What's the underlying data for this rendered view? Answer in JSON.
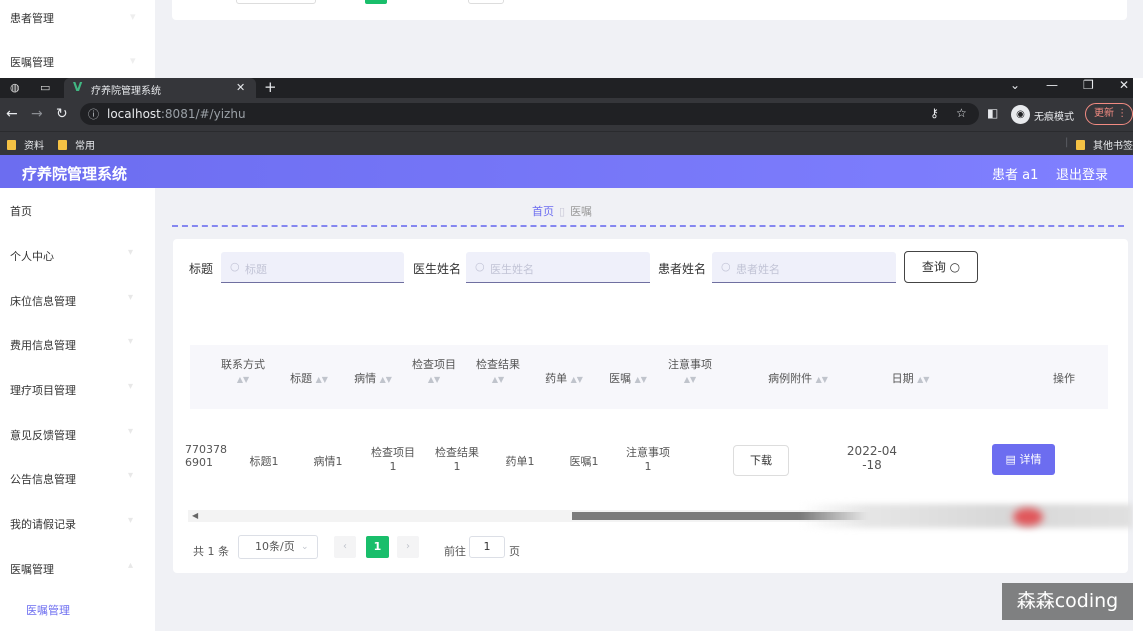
{
  "ghost": {
    "items": [
      "患者管理",
      "医嘱管理"
    ]
  },
  "browser": {
    "tab_title": "疗养院管理系统",
    "url_host": "localhost",
    "url_path": ":8081/#/yizhu",
    "profile_label": "无痕模式",
    "update_label": "更新",
    "bookmarks": [
      "资料",
      "常用"
    ],
    "other_bookmarks": "其他书签"
  },
  "header": {
    "title": "疗养院管理系统",
    "user": "患者 a1",
    "logout": "退出登录"
  },
  "sidebar": {
    "items": [
      "首页",
      "个人中心",
      "床位信息管理",
      "费用信息管理",
      "理疗项目管理",
      "意见反馈管理",
      "公告信息管理",
      "我的请假记录",
      "医嘱管理"
    ],
    "sub_item": "医嘱管理"
  },
  "breadcrumb": {
    "home": "首页",
    "current": "医嘱"
  },
  "search": {
    "title_label": "标题",
    "title_placeholder": "标题",
    "doctor_label": "医生姓名",
    "doctor_placeholder": "医生姓名",
    "patient_label": "患者姓名",
    "patient_placeholder": "患者姓名",
    "query_button": "查询"
  },
  "table": {
    "headers": [
      "联系方式",
      "标题",
      "病情",
      "检查项目",
      "检查结果",
      "药单",
      "医嘱",
      "注意事项",
      "病例附件",
      "日期",
      "操作"
    ],
    "row": {
      "phone_line1": "770378",
      "phone_line2": "6901",
      "title": "标题1",
      "condition": "病情1",
      "exam_item_line1": "检查项目",
      "exam_item_line2": "1",
      "exam_result_line1": "检查结果",
      "exam_result_line2": "1",
      "prescription": "药单1",
      "advice": "医嘱1",
      "notes_line1": "注意事项",
      "notes_line2": "1",
      "download": "下载",
      "date_line1": "2022-04",
      "date_line2": "-18",
      "detail": "详情"
    }
  },
  "pagination": {
    "total": "共 1 条",
    "page_size": "10条/页",
    "current": "1",
    "goto": "前往",
    "goto_value": "1",
    "unit": "页"
  },
  "watermark": "森森coding",
  "colors": {
    "accent": "#6c6df0",
    "pager_active": "#19be6b",
    "browser_dark": "#202124"
  }
}
